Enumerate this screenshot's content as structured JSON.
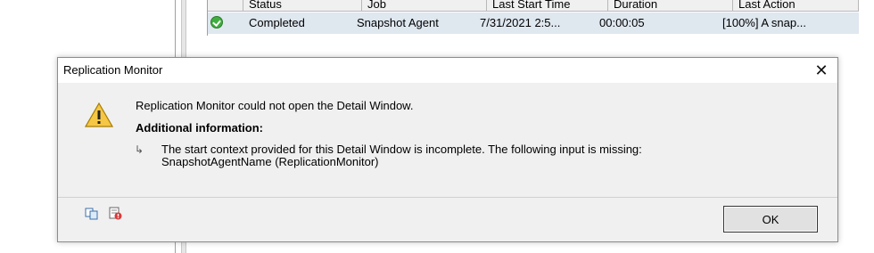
{
  "background": {
    "columns": [
      "Status",
      "Job",
      "Last Start Time",
      "Duration",
      "Last Action"
    ],
    "row": {
      "status_icon": "check-icon",
      "status": "Completed",
      "job": "Snapshot Agent",
      "last_start_time": "7/31/2021 2:5...",
      "duration": "00:00:05",
      "last_action": "[100%] A snap..."
    }
  },
  "dialog": {
    "title": "Replication Monitor",
    "close_glyph": "✕",
    "icon": "warning-icon",
    "message": "Replication Monitor could not open the Detail Window.",
    "additional_label": "Additional information:",
    "detail_arrow_glyph": "↳",
    "detail_text": "The start context provided for this Detail Window is incomplete. The following input is missing:\nSnapshotAgentName (ReplicationMonitor)",
    "copy_icon": "copy-icon",
    "details_icon": "technical-details-icon",
    "ok_label": "OK"
  }
}
